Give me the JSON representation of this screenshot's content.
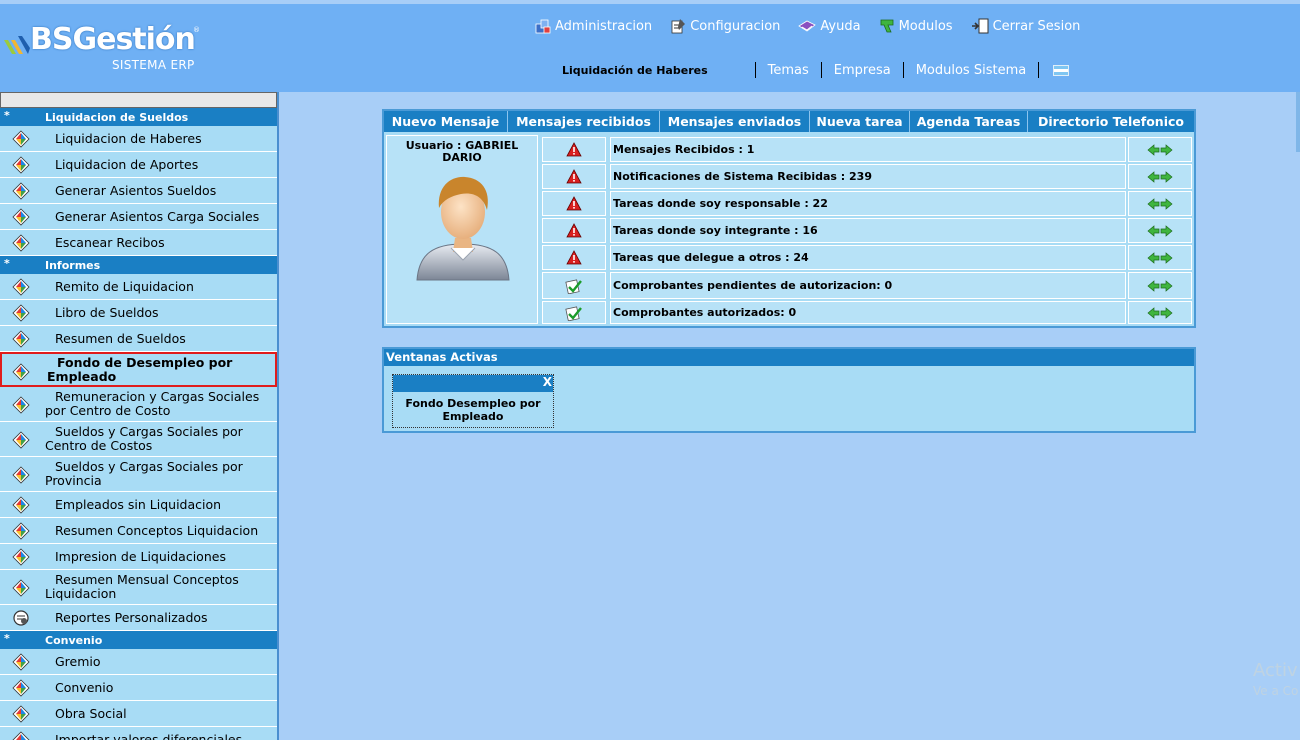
{
  "brand": {
    "name": "BSGestión",
    "subtitle": "SISTEMA ERP",
    "reg": "®"
  },
  "topnav": {
    "items": [
      {
        "label": "Administracion",
        "icon": "admin-icon"
      },
      {
        "label": "Configuracion",
        "icon": "config-icon"
      },
      {
        "label": "Ayuda",
        "icon": "help-icon"
      },
      {
        "label": "Modulos",
        "icon": "modules-icon"
      },
      {
        "label": "Cerrar Sesion",
        "icon": "logout-icon"
      }
    ]
  },
  "subnav": {
    "current": "Liquidación de Haberes",
    "links": [
      "Temas",
      "Empresa",
      "Modulos Sistema"
    ]
  },
  "sidebar": {
    "sections": [
      {
        "star": "*",
        "title": "Liquidacion de Sueldos",
        "items": [
          "Liquidacion de Haberes",
          "Liquidacion de Aportes",
          "Generar Asientos Sueldos",
          "Generar Asientos Carga Sociales",
          "Escanear Recibos"
        ]
      },
      {
        "star": "*",
        "title": "Informes",
        "items": [
          "Remito de Liquidacion",
          "Libro de Sueldos",
          "Resumen de Sueldos",
          "Fondo de Desempleo por Empleado",
          "Remuneracion y Cargas Sociales por Centro de Costo",
          "Sueldos y Cargas Sociales por Centro de Costos",
          "Sueldos y Cargas Sociales por Provincia",
          "Empleados sin Liquidacion",
          "Resumen Conceptos Liquidacion",
          "Impresion de Liquidaciones",
          "Resumen Mensual Conceptos Liquidacion",
          "Reportes Personalizados"
        ]
      },
      {
        "star": "*",
        "title": "Convenio",
        "items": [
          "Gremio",
          "Convenio",
          "Obra Social",
          "Importar valores diferenciales"
        ]
      }
    ]
  },
  "tabs": [
    "Nuevo Mensaje",
    "Mensajes recibidos",
    "Mensajes enviados",
    "Nueva tarea",
    "Agenda Tareas",
    "Directorio Telefonico"
  ],
  "user": {
    "label": "Usuario : GABRIEL DARIO"
  },
  "rows": [
    {
      "text": "Mensajes Recibidos : 1",
      "status": "warning-icon"
    },
    {
      "text": "Notificaciones de Sistema Recibidas : 239",
      "status": "warning-icon"
    },
    {
      "text": "Tareas donde soy responsable : 22",
      "status": "warning-icon"
    },
    {
      "text": "Tareas donde soy integrante : 16",
      "status": "warning-icon"
    },
    {
      "text": "Tareas que delegue a otros : 24",
      "status": "warning-icon"
    },
    {
      "text": "Comprobantes pendientes de autorizacion: 0",
      "status": "ok-icon"
    },
    {
      "text": "Comprobantes autorizados: 0",
      "status": "ok-icon"
    }
  ],
  "active_windows": {
    "title": "Ventanas Activas",
    "close": "X",
    "windows": [
      "Fondo Desempleo por Empleado"
    ]
  },
  "watermark": {
    "line1": "Activ",
    "line2": "Ve a Co"
  }
}
